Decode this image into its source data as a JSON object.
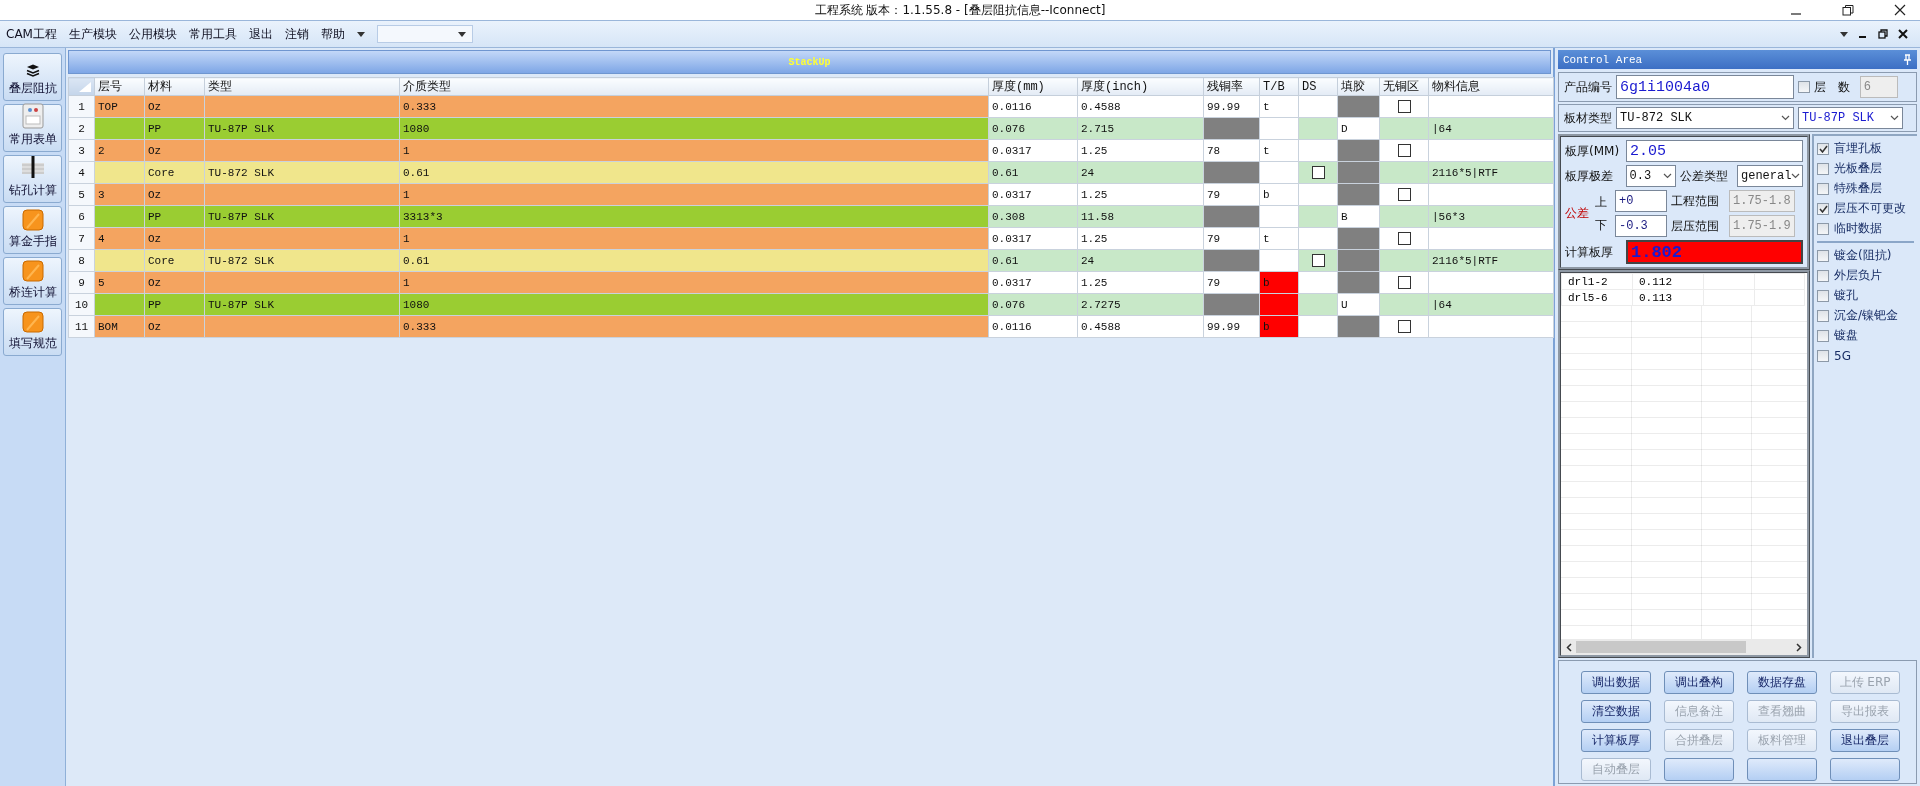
{
  "window": {
    "title": "工程系统  版本：1.1.55.8 - [叠层阻抗信息--Iconnect]"
  },
  "menu": [
    "CAM工程",
    "生产模块",
    "公用模块",
    "常用工具",
    "退出",
    "注销",
    "帮助"
  ],
  "sidebar": [
    {
      "label": "叠层阻抗",
      "kind": "layers"
    },
    {
      "label": "常用表单",
      "kind": "form"
    },
    {
      "label": "钻孔计算",
      "kind": "drill"
    },
    {
      "label": "算金手指",
      "kind": "tile"
    },
    {
      "label": "桥连计算",
      "kind": "tile"
    },
    {
      "label": "填写规范",
      "kind": "tile"
    }
  ],
  "stackup": {
    "title": "StackUp",
    "columns": [
      "层号",
      "材料",
      "类型",
      "介质类型",
      "厚度(mm)",
      "厚度(inch)",
      "残铜率",
      "T/B",
      "DS",
      "填胶",
      "无铜区",
      "物料信息"
    ],
    "rows": [
      {
        "num": "1",
        "kind": "copper",
        "tb_flagged": false,
        "cells": [
          "TOP",
          "Oz",
          {
            "kind": "empty"
          },
          "0.333",
          "0.0116",
          "0.4588",
          "99.99",
          "t",
          {
            "kind": "empty"
          },
          {
            "kind": "blocked"
          },
          {
            "kind": "checkbox",
            "checked": false
          },
          {
            "kind": "empty"
          }
        ]
      },
      {
        "num": "2",
        "kind": "prepreg",
        "tb_flagged": false,
        "cells": [
          {
            "kind": "empty"
          },
          "PP",
          "TU-87P SLK",
          "1080",
          "0.076",
          "2.715",
          {
            "kind": "blocked"
          },
          {
            "kind": "empty"
          },
          {
            "kind": "empty"
          },
          "D",
          {
            "kind": "empty"
          },
          "|64"
        ]
      },
      {
        "num": "3",
        "kind": "copper",
        "tb_flagged": false,
        "cells": [
          "2",
          "Oz",
          {
            "kind": "empty"
          },
          "1",
          "0.0317",
          "1.25",
          "78",
          "t",
          {
            "kind": "empty"
          },
          {
            "kind": "blocked"
          },
          {
            "kind": "checkbox",
            "checked": false
          },
          {
            "kind": "empty"
          }
        ]
      },
      {
        "num": "4",
        "kind": "core",
        "tb_flagged": false,
        "cells": [
          {
            "kind": "empty"
          },
          "Core",
          "TU-872 SLK",
          "0.61",
          "0.61",
          "24",
          {
            "kind": "blocked"
          },
          {
            "kind": "empty"
          },
          {
            "kind": "checkbox",
            "checked": false
          },
          {
            "kind": "blocked"
          },
          {
            "kind": "empty"
          },
          "2116*5|RTF"
        ]
      },
      {
        "num": "5",
        "kind": "copper",
        "tb_flagged": false,
        "cells": [
          "3",
          "Oz",
          {
            "kind": "empty"
          },
          "1",
          "0.0317",
          "1.25",
          "79",
          "b",
          {
            "kind": "empty"
          },
          {
            "kind": "blocked"
          },
          {
            "kind": "checkbox",
            "checked": false
          },
          {
            "kind": "empty"
          }
        ]
      },
      {
        "num": "6",
        "kind": "prepreg",
        "tb_flagged": false,
        "cells": [
          {
            "kind": "empty"
          },
          "PP",
          "TU-87P SLK",
          "3313*3",
          "0.308",
          "11.58",
          {
            "kind": "blocked"
          },
          {
            "kind": "empty"
          },
          {
            "kind": "empty"
          },
          "B",
          {
            "kind": "empty"
          },
          "|56*3"
        ]
      },
      {
        "num": "7",
        "kind": "copper",
        "tb_flagged": false,
        "cells": [
          "4",
          "Oz",
          {
            "kind": "empty"
          },
          "1",
          "0.0317",
          "1.25",
          "79",
          "t",
          {
            "kind": "empty"
          },
          {
            "kind": "blocked"
          },
          {
            "kind": "checkbox",
            "checked": false
          },
          {
            "kind": "empty"
          }
        ]
      },
      {
        "num": "8",
        "kind": "core",
        "tb_flagged": false,
        "cells": [
          {
            "kind": "empty"
          },
          "Core",
          "TU-872 SLK",
          "0.61",
          "0.61",
          "24",
          {
            "kind": "blocked"
          },
          {
            "kind": "empty"
          },
          {
            "kind": "checkbox",
            "checked": false
          },
          {
            "kind": "blocked"
          },
          {
            "kind": "empty"
          },
          "2116*5|RTF"
        ]
      },
      {
        "num": "9",
        "kind": "copper",
        "tb_flagged": true,
        "cells": [
          "5",
          "Oz",
          {
            "kind": "empty"
          },
          "1",
          "0.0317",
          "1.25",
          "79",
          "b",
          {
            "kind": "empty"
          },
          {
            "kind": "blocked"
          },
          {
            "kind": "checkbox",
            "checked": false
          },
          {
            "kind": "empty"
          }
        ]
      },
      {
        "num": "10",
        "kind": "prepreg",
        "tb_flagged": true,
        "cells": [
          {
            "kind": "empty"
          },
          "PP",
          "TU-87P SLK",
          "1080",
          "0.076",
          "2.7275",
          {
            "kind": "blocked"
          },
          {
            "kind": "empty"
          },
          {
            "kind": "empty"
          },
          "U",
          {
            "kind": "empty"
          },
          "|64"
        ]
      },
      {
        "num": "11",
        "kind": "copper",
        "tb_flagged": true,
        "cells": [
          "BOM",
          "Oz",
          {
            "kind": "empty"
          },
          "0.333",
          "0.0116",
          "0.4588",
          "99.99",
          "b",
          {
            "kind": "empty"
          },
          {
            "kind": "blocked"
          },
          {
            "kind": "checkbox",
            "checked": false
          },
          {
            "kind": "empty"
          }
        ]
      }
    ]
  },
  "control_area": {
    "title": "Control Area",
    "product_no": {
      "label": "产品编号",
      "value": "6g1i1004a0"
    },
    "layer_count": {
      "label": "层 数",
      "checked": false,
      "value": "6"
    },
    "board_material": {
      "label": "板材类型",
      "core": "TU-872 SLK",
      "prepreg": "TU-87P SLK"
    },
    "thickness": {
      "label": "板厚(MM)",
      "value": "2.05"
    },
    "thickness_range": {
      "label": "板厚极差",
      "value": "0.3"
    },
    "tolerance_type": {
      "label": "公差类型",
      "value": "general"
    },
    "tolerance": {
      "label": "公差",
      "upper_label": "上",
      "upper": "+0",
      "lower_label": "下",
      "lower": "-0.3"
    },
    "eng_range": {
      "label": "工程范围",
      "value": "1.75-1.8"
    },
    "press_range": {
      "label": "层压范围",
      "value": "1.75-1.9"
    },
    "calc_thickness": {
      "label": "计算板厚",
      "value": "1.802",
      "alert": true
    },
    "drill_table": {
      "rows": [
        [
          "drl1-2",
          "0.112"
        ],
        [
          "drl5-6",
          "0.113"
        ]
      ]
    },
    "option_groups": [
      [
        {
          "label": "盲埋孔板",
          "checked": true
        },
        {
          "label": "光板叠层",
          "checked": false
        },
        {
          "label": "特殊叠层",
          "checked": false
        },
        {
          "label": "层压不可更改",
          "checked": true
        },
        {
          "label": "临时数据",
          "checked": false
        }
      ],
      [
        {
          "label": "镀金(阻抗)",
          "checked": false
        },
        {
          "label": "外层负片",
          "checked": false
        },
        {
          "label": "镀孔",
          "checked": false
        },
        {
          "label": "沉金/镍钯金",
          "checked": false
        },
        {
          "label": "镀盘",
          "checked": false
        },
        {
          "label": "5G",
          "checked": false
        }
      ]
    ],
    "buttons": [
      {
        "label": "调出数据",
        "disabled": false
      },
      {
        "label": "调出叠构",
        "disabled": false
      },
      {
        "label": "数据存盘",
        "disabled": false
      },
      {
        "label": "上传 ERP",
        "disabled": true
      },
      {
        "label": "清空数据",
        "disabled": false
      },
      {
        "label": "信息备注",
        "disabled": true
      },
      {
        "label": "查看翘曲",
        "disabled": true
      },
      {
        "label": "导出报表",
        "disabled": true
      },
      {
        "label": "计算板厚",
        "disabled": false
      },
      {
        "label": "合拼叠层",
        "disabled": true
      },
      {
        "label": "板料管理",
        "disabled": true
      },
      {
        "label": "退出叠层",
        "disabled": false
      },
      {
        "label": "自动叠层",
        "disabled": true
      },
      {
        "disabled": false
      },
      {
        "disabled": false
      },
      {
        "disabled": false
      }
    ]
  }
}
